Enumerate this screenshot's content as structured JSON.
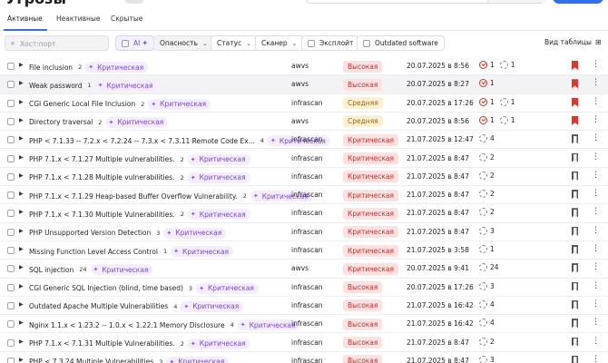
{
  "header": {
    "title": "Угрозы"
  },
  "tabs": [
    {
      "label": "Активные"
    },
    {
      "label": "Неактивные"
    },
    {
      "label": "Скрытые"
    }
  ],
  "filters": {
    "search_placeholder": "Хост:порт",
    "ai_label": "AI",
    "danger_label": "Опасность",
    "status_label": "Статус",
    "scanner_label": "Сканер",
    "exploit_label": "Эксплойт",
    "outdated_label": "Outdated software",
    "view_label": "Вид таблицы"
  },
  "rows": [
    {
      "name": "File inclusion",
      "count": "2",
      "criticality": "Критическая",
      "scanner": "awvs",
      "severity": "Высокая",
      "sev_class": "high",
      "date": "20.07.2025 в 8:56",
      "status": "red",
      "open": "1",
      "pending": "1",
      "bookmarked": true
    },
    {
      "name": "Weak password",
      "count": "1",
      "criticality": "Критическая",
      "scanner": "awvs",
      "severity": "Высокая",
      "sev_class": "high",
      "date": "20.07.2025 в 8:27",
      "status": "red",
      "open": "1",
      "pending": "",
      "bookmarked": true
    },
    {
      "name": "CGI Generic Local File Inclusion",
      "count": "2",
      "criticality": "Критическая",
      "scanner": "infrascan",
      "severity": "Средняя",
      "sev_class": "mid",
      "date": "20.07.2025 в 17:26",
      "status": "red",
      "open": "1",
      "pending": "1",
      "bookmarked": true
    },
    {
      "name": "Directory traversal",
      "count": "2",
      "criticality": "Критическая",
      "scanner": "awvs",
      "severity": "Средняя",
      "sev_class": "mid",
      "date": "20.07.2025 в 8:56",
      "status": "red",
      "open": "1",
      "pending": "1",
      "bookmarked": true
    },
    {
      "name": "PHP < 7.1.33 -- 7.2.x < 7.2.24 -- 7.3.x < 7.3.11 Remote Code Ex...",
      "count": "4",
      "criticality": "Критическая",
      "scanner": "infrascan",
      "severity": "Критическая",
      "sev_class": "crit",
      "date": "21.07.2025 в 12:47",
      "status": "dash",
      "open": "",
      "pending": "4",
      "bookmarked": false
    },
    {
      "name": "PHP 7.1.x < 7.1.27 Multiple vulnerabilities.",
      "count": "2",
      "criticality": "Критическая",
      "scanner": "infrascan",
      "severity": "Критическая",
      "sev_class": "crit",
      "date": "21.07.2025 в 8:47",
      "status": "dash",
      "open": "",
      "pending": "2",
      "bookmarked": false
    },
    {
      "name": "PHP 7.1.x < 7.1.28 Multiple vulnerabilities.",
      "count": "2",
      "criticality": "Критическая",
      "scanner": "infrascan",
      "severity": "Критическая",
      "sev_class": "crit",
      "date": "21.07.2025 в 8:47",
      "status": "dash",
      "open": "",
      "pending": "2",
      "bookmarked": false
    },
    {
      "name": "PHP 7.1.x < 7.1.29 Heap-based Buffer Overflow Vulnerability.",
      "count": "2",
      "criticality": "Критическая",
      "scanner": "infrascan",
      "severity": "Критическая",
      "sev_class": "crit",
      "date": "21.07.2025 в 8:47",
      "status": "dash",
      "open": "",
      "pending": "2",
      "bookmarked": false
    },
    {
      "name": "PHP 7.1.x < 7.1.30 Multiple Vulnerabilities.",
      "count": "2",
      "criticality": "Критическая",
      "scanner": "infrascan",
      "severity": "Критическая",
      "sev_class": "crit",
      "date": "21.07.2025 в 8:47",
      "status": "dash",
      "open": "",
      "pending": "2",
      "bookmarked": false
    },
    {
      "name": "PHP Unsupported Version Detection",
      "count": "3",
      "criticality": "Критическая",
      "scanner": "infrascan",
      "severity": "Критическая",
      "sev_class": "crit",
      "date": "21.07.2025 в 8:47",
      "status": "dash",
      "open": "",
      "pending": "3",
      "bookmarked": false
    },
    {
      "name": "Missing Function Level Access Control",
      "count": "1",
      "criticality": "Критическая",
      "scanner": "infrascan",
      "severity": "Критическая",
      "sev_class": "crit",
      "date": "21.07.2025 в 3:58",
      "status": "dash",
      "open": "",
      "pending": "1",
      "bookmarked": false
    },
    {
      "name": "SQL injection",
      "count": "24",
      "criticality": "Критическая",
      "scanner": "awvs",
      "severity": "Критическая",
      "sev_class": "crit",
      "date": "20.07.2025 в 9:41",
      "status": "dash",
      "open": "",
      "pending": "24",
      "bookmarked": false
    },
    {
      "name": "CGI Generic SQL Injection (blind, time based)",
      "count": "3",
      "criticality": "Критическая",
      "scanner": "infrascan",
      "severity": "Высокая",
      "sev_class": "high",
      "date": "20.07.2025 в 17:26",
      "status": "dash",
      "open": "",
      "pending": "3",
      "bookmarked": false
    },
    {
      "name": "Outdated Apache Multiple Vulnerabilities",
      "count": "4",
      "criticality": "Критическая",
      "scanner": "infrascan",
      "severity": "Высокая",
      "sev_class": "high",
      "date": "21.07.2025 в 16:42",
      "status": "dash",
      "open": "",
      "pending": "4",
      "bookmarked": false
    },
    {
      "name": "Nginx 1.1.x < 1.23.2 -- 1.0.x < 1.22.1 Memory Disclosure",
      "count": "4",
      "criticality": "Критическая",
      "scanner": "infrascan",
      "severity": "Высокая",
      "sev_class": "high",
      "date": "21.07.2025 в 16:42",
      "status": "dash",
      "open": "",
      "pending": "4",
      "bookmarked": false
    },
    {
      "name": "PHP 7.1.x < 7.1.31 Multiple Vulnerabilities.",
      "count": "2",
      "criticality": "Критическая",
      "scanner": "infrascan",
      "severity": "Высокая",
      "sev_class": "high",
      "date": "21.07.2025 в 8:47",
      "status": "dash",
      "open": "",
      "pending": "2",
      "bookmarked": false
    },
    {
      "name": "PHP < 7.3.24 Multiple Vulnerabilities",
      "count": "3",
      "criticality": "Критическая",
      "scanner": "infrascan",
      "severity": "Высокая",
      "sev_class": "high",
      "date": "21.07.2025 в 8:47",
      "status": "dash",
      "open": "",
      "pending": "3",
      "bookmarked": false
    }
  ]
}
